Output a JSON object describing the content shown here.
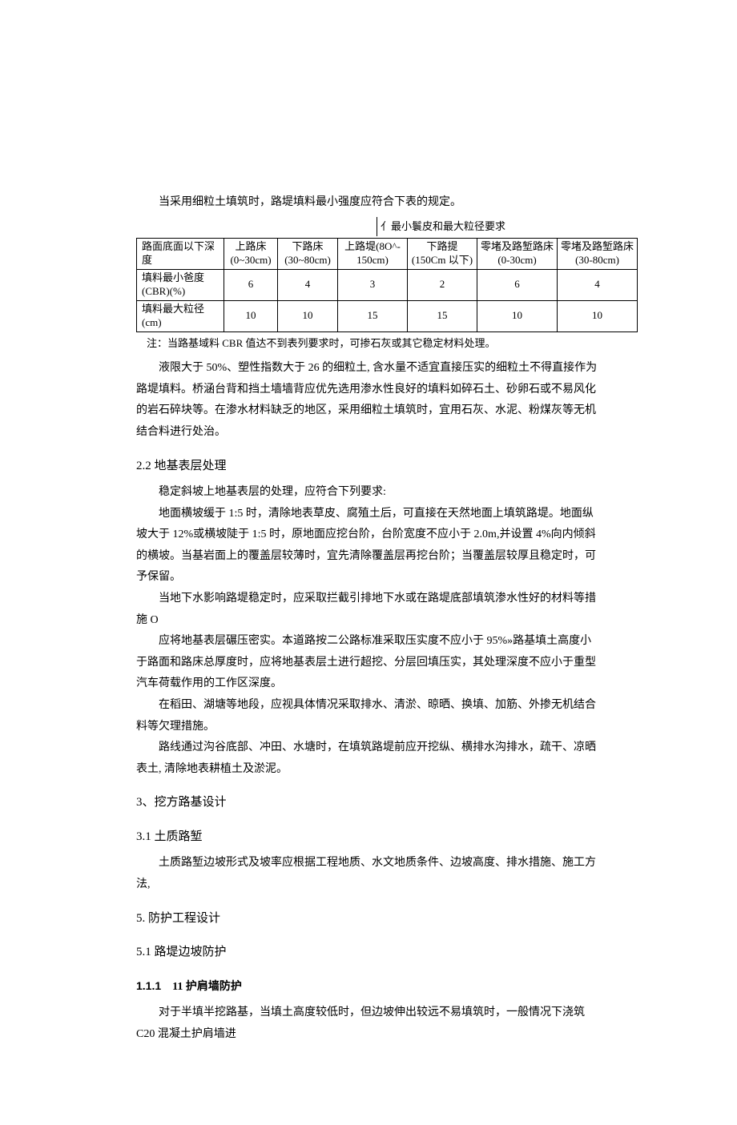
{
  "p1": "当采用细粒土填筑时，路堤填料最小强度应符合下表的规定。",
  "tableTitle": "亻最小鬟皮和最大粒径要求",
  "table": {
    "h_r1c1": "路面底面以下深度",
    "h_upper": "上路床",
    "h_upper_sub": "(0~30cm)",
    "h_lower": "下路床",
    "h_lower_sub": "(30~80cm)",
    "h_upemb": "上路堤(8O^-",
    "h_upemb_sub": "150cm)",
    "h_lowemb": "下路提",
    "h_lowemb_sub": "(150Cm 以下)",
    "h_zero1": "零堵及路堑路床",
    "h_zero1_sub": "(0-30cm)",
    "h_zero2": "零堵及路堑路床",
    "h_zero2_sub": "(30-80cm)",
    "r2_label": "填料最小爸度(CBR)(%)",
    "r2v": [
      "6",
      "4",
      "3",
      "2",
      "6",
      "4"
    ],
    "r3_label": "填料最大粒径(cm)",
    "r3v": [
      "10",
      "10",
      "15",
      "15",
      "10",
      "10"
    ]
  },
  "note": "注：当路基域料 CBR 值达不到表列要求时，可掺石灰或其它稳定材料处理。",
  "p2": "液限大于 50%、塑性指数大于 26 的细粒土, 含水量不适宜直接压实的细粒土不得直接作为路堤填料。桥涵台背和挡土墙墙背应优先选用渗水性良好的填料如碎石土、砂卵石或不易风化的岩石碎块等。在渗水材料缺乏的地区，采用细粒土填筑时，宜用石灰、水泥、粉煤灰等无机结合料进行处治。",
  "h22": "2.2  地基表层处理",
  "p3": "稳定斜坡上地基表层的处理，应符合下列要求:",
  "p4": "地面横坡缓于 1:5 时，清除地表草皮、腐殖土后，可直接在天然地面上填筑路堤。地面纵坡大于 12%或横坡陡于 1:5 时，原地面应挖台阶，台阶宽度不应小于 2.0m,并设置 4%向内倾斜的横坡。当基岩面上的覆盖层较薄时，宜先清除覆盖层再挖台阶；当覆盖层较厚且稳定时，可予保留。",
  "p5": "当地下水影响路堤稳定时，应采取拦截引排地下水或在路堤底部填筑渗水性好的材料等措施 O",
  "p6": "应将地基表层碾压密实。本道路按二公路标准采取压实度不应小于 95%»路基填土高度小于路面和路床总厚度时，应将地基表层土进行超挖、分层回填压实，其处理深度不应小于重型汽车荷载作用的工作区深度。",
  "p7": "在稻田、湖塘等地段，应视具体情况采取排水、清淤、晾晒、换填、加筋、外掺无机结合料等欠理措施。",
  "p8": "路线通过沟谷底部、冲田、水塘时，在填筑路堤前应开挖纵、横排水沟排水，疏干、凉晒表土, 清除地表耕植土及淤泥。",
  "h3": "3、挖方路基设计",
  "h31": "3.1 土质路堑",
  "p9": "土质路堑边坡形式及坡率应根据工程地质、水文地质条件、边坡高度、排水措施、施工方法,",
  "h5": "5. 防护工程设计",
  "h51": "5.1  路堤边坡防护",
  "h111_num": "1.1.1",
  "h111_txt": "11 护肩墙防护",
  "p10": "对于半填半挖路基，当填土高度较低时，但边坡伸出较远不易填筑时，一般情况下浇筑 C20 混凝土护肩墙进"
}
